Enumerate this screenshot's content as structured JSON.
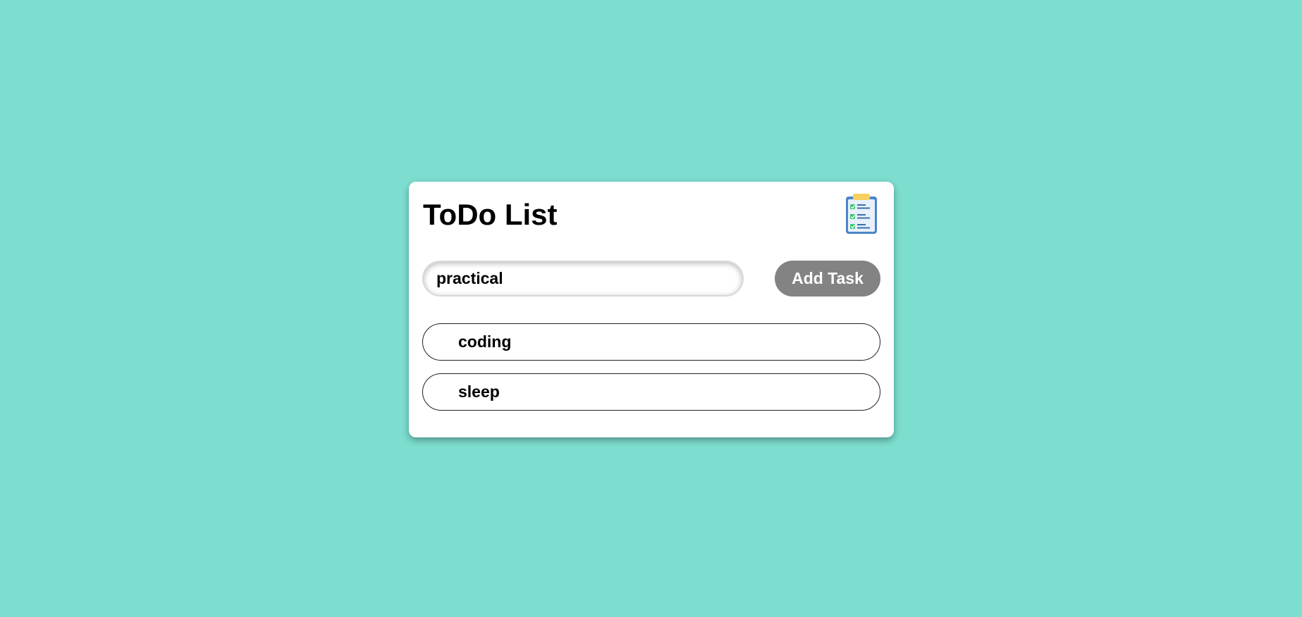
{
  "app": {
    "title": "ToDo List",
    "header_icon": "clipboard-checklist-icon"
  },
  "input": {
    "value": "practical",
    "placeholder": ""
  },
  "add_button": {
    "label": "Add Task"
  },
  "tasks": [
    {
      "label": "coding"
    },
    {
      "label": "sleep"
    }
  ],
  "colors": {
    "background": "#7ddecf",
    "card": "#ffffff",
    "button": "#838383",
    "button_text": "#ffffff"
  }
}
